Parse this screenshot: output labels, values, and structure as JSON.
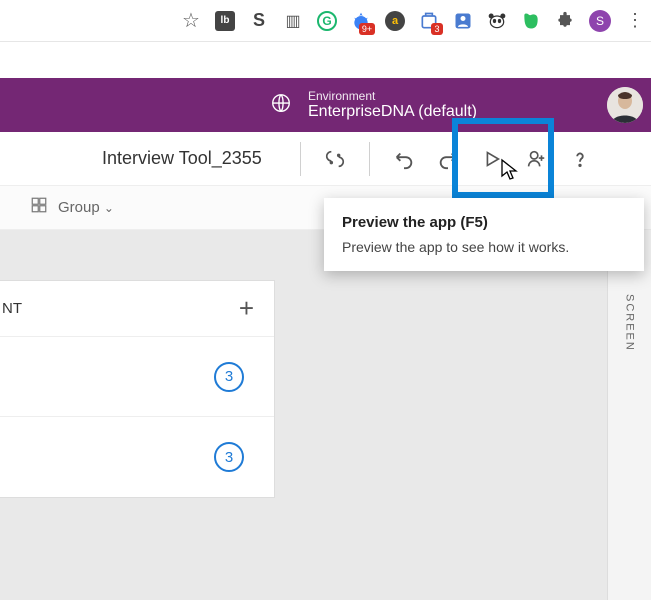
{
  "browser": {
    "avatar_letter": "S",
    "ext_badge": "3",
    "ext_inbox_badge": "9+"
  },
  "header": {
    "env_label": "Environment",
    "env_name": "EnterpriseDNA (default)"
  },
  "toolbar": {
    "app_name": "Interview Tool_2355"
  },
  "secondary": {
    "group_label": "Group"
  },
  "tooltip": {
    "title": "Preview the app (F5)",
    "body": "Preview the app to see how it works."
  },
  "panel": {
    "nt_label": "NT",
    "count_a": "3",
    "count_b": "3"
  },
  "right": {
    "screen_label": "SCREEN"
  }
}
